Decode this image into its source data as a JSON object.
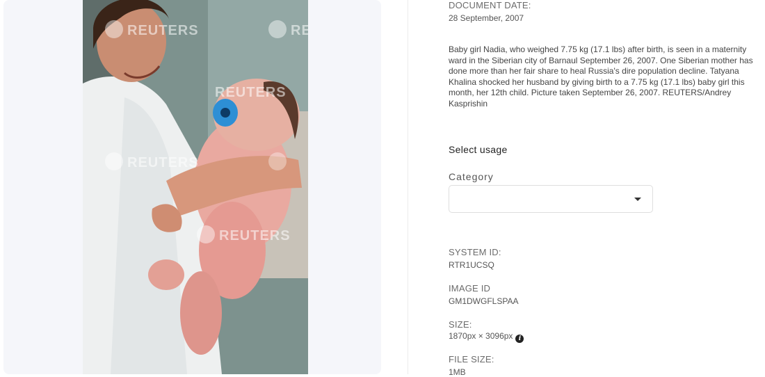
{
  "photo": {
    "watermark_text": "REUTERS"
  },
  "document_date": {
    "label": "DOCUMENT DATE:",
    "value": "28 September, 2007"
  },
  "caption": "Baby girl Nadia, who weighed 7.75 kg (17.1 lbs) after birth, is seen in a maternity ward in the Siberian city of Barnaul September 26, 2007. One Siberian mother has done more than her fair share to heal Russia's dire population decline. Tatyana Khalina shocked her husband by giving birth to a 7.75 kg (17.1 lbs) baby girl this month, her 12th child. Picture taken September 26, 2007. REUTERS/Andrey Kasprishin",
  "usage": {
    "heading": "Select usage",
    "category_label": "Category",
    "category_value": ""
  },
  "system_id": {
    "label": "SYSTEM ID:",
    "value": "RTR1UCSQ"
  },
  "image_id": {
    "label": "IMAGE ID",
    "value": "GM1DWGFLSPAA"
  },
  "size": {
    "label": "SIZE:",
    "value": "1870px × 3096px"
  },
  "file_size": {
    "label": "FILE SIZE:",
    "value": "1MB"
  },
  "icons": {
    "info": "info-icon",
    "dropdown": "caret-down-icon"
  }
}
